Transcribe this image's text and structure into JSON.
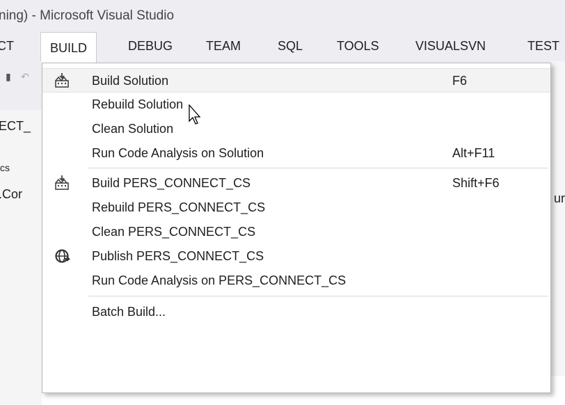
{
  "title": "ning) - Microsoft Visual Studio",
  "menubar": {
    "items": [
      {
        "label": "CT"
      },
      {
        "label": "BUILD",
        "active": true
      },
      {
        "label": "DEBUG"
      },
      {
        "label": "TEAM"
      },
      {
        "label": "SQL"
      },
      {
        "label": "TOOLS"
      },
      {
        "label": "VISUALSVN"
      },
      {
        "label": "TEST"
      }
    ]
  },
  "background_fragments": {
    "left": [
      "ECT_",
      "cs ",
      ".Cor"
    ],
    "right": [
      "ur"
    ]
  },
  "build_menu": {
    "items": [
      {
        "label": "Build Solution",
        "shortcut": "F6",
        "icon": "build-icon",
        "hovered": true
      },
      {
        "label": "Rebuild Solution",
        "shortcut": ""
      },
      {
        "label": "Clean Solution",
        "shortcut": ""
      },
      {
        "label": "Run Code Analysis on Solution",
        "shortcut": "Alt+F11"
      },
      {
        "label": "Build PERS_CONNECT_CS",
        "shortcut": "Shift+F6",
        "icon": "build-icon"
      },
      {
        "label": "Rebuild PERS_CONNECT_CS",
        "shortcut": ""
      },
      {
        "label": "Clean PERS_CONNECT_CS",
        "shortcut": ""
      },
      {
        "label": "Publish PERS_CONNECT_CS",
        "shortcut": "",
        "icon": "publish-globe-icon"
      },
      {
        "label": "Run Code Analysis on PERS_CONNECT_CS",
        "shortcut": ""
      },
      {
        "label": "Batch Build...",
        "shortcut": ""
      }
    ]
  },
  "colors": {
    "chrome_bg": "#eeeef2",
    "menu_bg": "#ffffff",
    "hover_bg": "#f3f3f3",
    "text": "#1e1e1e"
  }
}
